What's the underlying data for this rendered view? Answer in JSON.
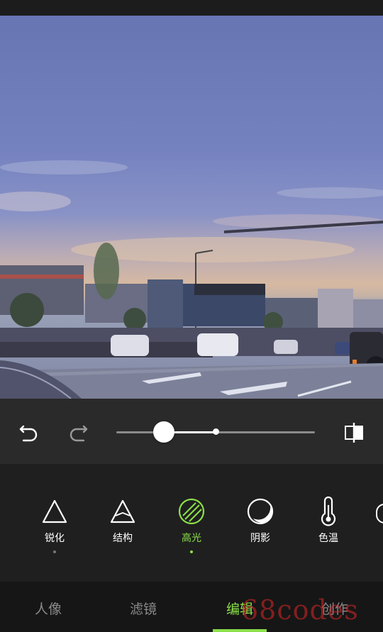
{
  "toolbar": {
    "undo_icon": "undo-icon",
    "redo_icon": "redo-icon",
    "compare_icon": "compare-icon",
    "slider_value": 0.24,
    "slider_center": 0.5
  },
  "tools": [
    {
      "label": "锐化",
      "icon": "triangle-icon",
      "has_dot": true
    },
    {
      "label": "结构",
      "icon": "structure-icon",
      "has_dot": false
    },
    {
      "label": "高光",
      "icon": "highlight-icon",
      "active": true,
      "has_dot": true
    },
    {
      "label": "阴影",
      "icon": "shadow-icon",
      "has_dot": false
    },
    {
      "label": "色温",
      "icon": "thermometer-icon",
      "has_dot": false
    }
  ],
  "tabs": [
    {
      "label": "人像"
    },
    {
      "label": "滤镜"
    },
    {
      "label": "编辑",
      "active": true
    },
    {
      "label": "创作"
    }
  ],
  "watermark": "68codes",
  "colors": {
    "accent": "#8be04a",
    "background": "#1e1e1e"
  }
}
